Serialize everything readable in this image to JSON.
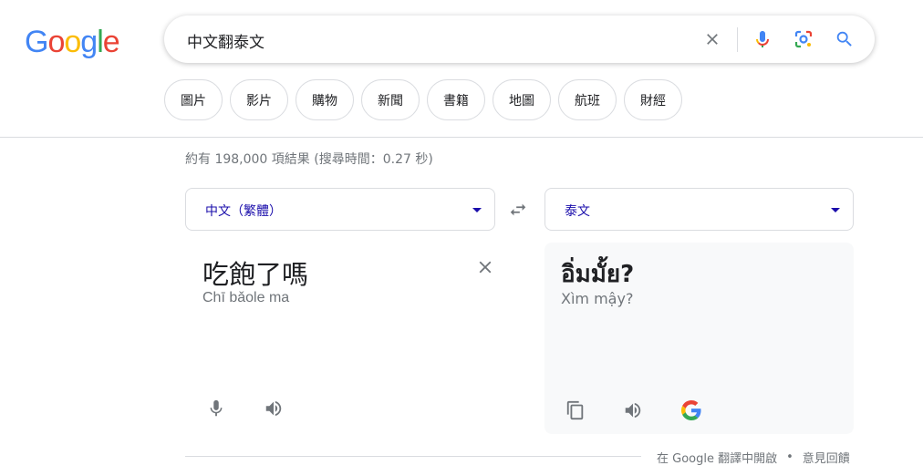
{
  "logo": {
    "letters": [
      "G",
      "o",
      "o",
      "g",
      "l",
      "e"
    ],
    "colors": [
      "#4285F4",
      "#EA4335",
      "#FBBC05",
      "#4285F4",
      "#34A853",
      "#EA4335"
    ]
  },
  "search": {
    "query": "中文翻泰文",
    "icons": [
      "close-icon",
      "mic-icon",
      "lens-icon",
      "search-icon"
    ]
  },
  "chips": [
    "圖片",
    "影片",
    "購物",
    "新聞",
    "書籍",
    "地圖",
    "航班",
    "財經"
  ],
  "result_stats": "約有 198,000 項結果 (搜尋時間：0.27 秒)",
  "translator": {
    "source_lang": "中文（繁體）",
    "target_lang": "泰文",
    "source_text": "吃飽了嗎",
    "source_romanization": "Chī bǎole ma",
    "target_text": "อิ่มมั้ย?",
    "target_romanization": "Xìm mậy?"
  },
  "footer": {
    "open_in_translate": "在 Google 翻譯中開啟",
    "separator": "•",
    "feedback": "意見回饋"
  },
  "colors": {
    "link_blue": "#1a0dab",
    "google_blue": "#4285F4",
    "gray_text": "#70757a",
    "border": "#dadce0"
  }
}
